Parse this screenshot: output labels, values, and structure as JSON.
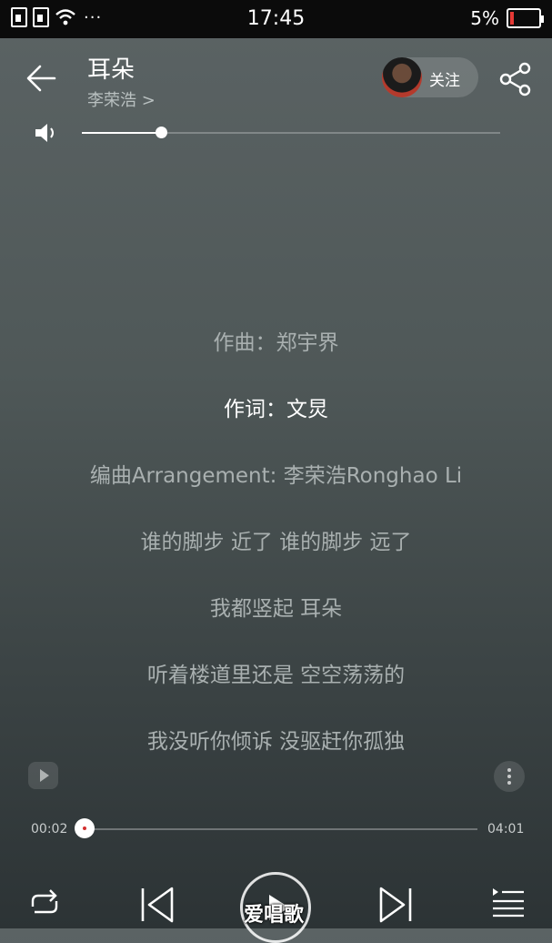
{
  "status_bar": {
    "time": "17:45",
    "battery": "5%",
    "signal_icons": [
      "sim-icon",
      "sim-icon",
      "wifi-icon"
    ],
    "notification_dots": "···"
  },
  "header": {
    "title": "耳朵",
    "artist": "李荣浩 >",
    "follow_label": "关注",
    "back_icon": "arrow-left-icon",
    "share_icon": "share-icon"
  },
  "volume": {
    "icon": "volume-icon",
    "level": 0.19
  },
  "lyrics": [
    {
      "text": "作曲：郑宇界",
      "active": false
    },
    {
      "text": "作词：文炅",
      "active": true
    },
    {
      "text": "编曲Arrangement:  李荣浩Ronghao Li",
      "active": false
    },
    {
      "text": "谁的脚步 近了 谁的脚步 远了",
      "active": false
    },
    {
      "text": "我都竖起 耳朵",
      "active": false
    },
    {
      "text": "听着楼道里还是 空空荡荡的",
      "active": false
    },
    {
      "text": "我没听你倾诉 没驱赶你孤独",
      "active": false
    }
  ],
  "progress": {
    "current": "00:02",
    "total": "04:01",
    "fraction": 0.0
  },
  "controls": {
    "repeat_icon": "repeat-icon",
    "prev_icon": "skip-previous-icon",
    "play_icon": "play-icon",
    "next_icon": "skip-next-icon",
    "playlist_icon": "playlist-icon"
  },
  "watermark": "爱唱歌",
  "colors": {
    "accent_red": "#d32f2f",
    "battery_low": "#e53935"
  }
}
